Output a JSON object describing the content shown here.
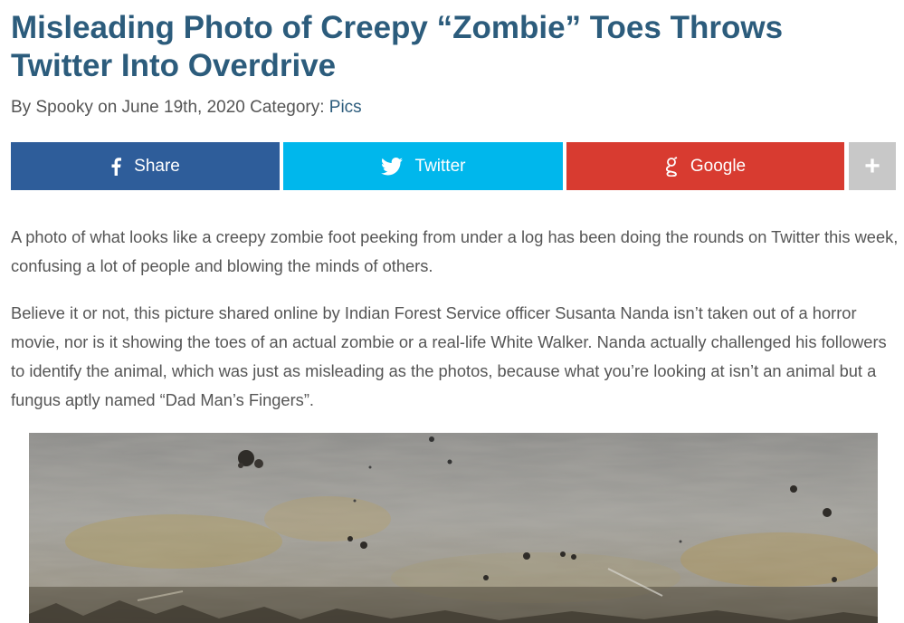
{
  "article": {
    "title": "Misleading Photo of Creepy “Zombie” Toes Throws Twitter Into Overdrive",
    "meta": {
      "by_prefix": "By",
      "author": "Spooky",
      "on_prefix": "on",
      "date": "June 19th, 2020",
      "category_label": "Category:",
      "category": "Pics"
    },
    "paragraphs": [
      "A photo of what looks like a creepy zombie foot peeking from under a log has been doing the rounds on Twitter this week, confusing a lot of people and blowing the minds of others.",
      "Believe it or not, this picture shared online by Indian Forest Service officer Susanta Nanda isn’t taken out of a horror movie, nor is it showing the toes of an actual zombie or a real-life White Walker. Nanda actually challenged his followers to identify the animal, which was just as misleading as the photos, because what you’re looking at isn’t an animal but a fungus aptly named “Dad Man’s Fingers”."
    ]
  },
  "share_bar": {
    "facebook": {
      "label": "Share",
      "icon": "facebook-icon",
      "color": "#2e5d9a"
    },
    "twitter": {
      "label": "Twitter",
      "icon": "twitter-bird-icon",
      "color": "#00b7ec"
    },
    "google": {
      "label": "Google",
      "icon": "google-g-icon",
      "color": "#d83b30"
    },
    "more": {
      "label": "+",
      "icon": "plus-icon",
      "color": "#c8c8c8"
    }
  },
  "colors": {
    "title": "#2c5c7c",
    "body_text": "#555555",
    "link": "#2c5c7c"
  }
}
